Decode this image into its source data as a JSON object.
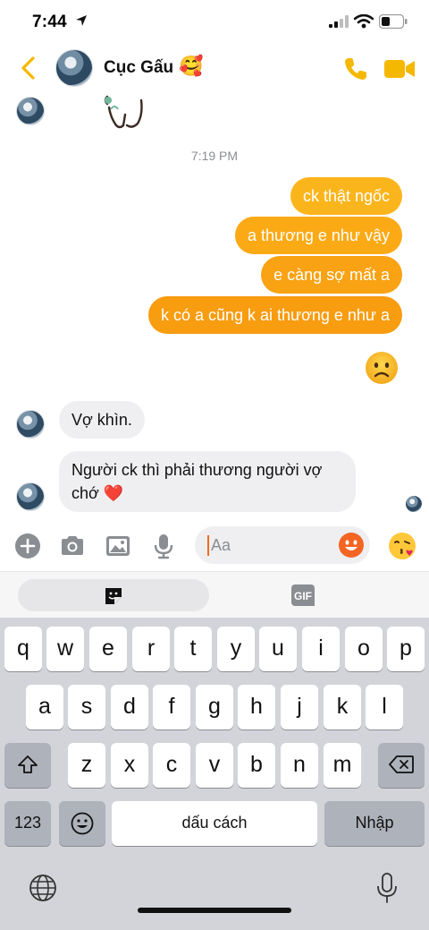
{
  "status_bar": {
    "time": "7:44",
    "icons": [
      "location-arrow-icon",
      "signal-icon",
      "wifi-icon",
      "battery-icon"
    ]
  },
  "header": {
    "contact_name": "Cục Gấu",
    "name_emoji": "🥰",
    "icons": [
      "back-chevron-icon",
      "phone-icon",
      "video-camera-icon"
    ],
    "accent_color": "#f5b800"
  },
  "conversation": {
    "timestamp": "7:19 PM",
    "outgoing": [
      "ck thật ngốc",
      "a thương e như vậy",
      "e càng sợ mất a",
      "k có a cũng k ai thương e như a"
    ],
    "incoming": [
      "Vợ khìn.",
      "Người ck thì phải thương người vợ chớ ❤️"
    ],
    "outgoing_gradient": [
      "#fbb51c",
      "#f89c10"
    ],
    "incoming_bg": "#efeff1"
  },
  "composer": {
    "placeholder": "Aa",
    "value": "",
    "icons": [
      "plus-icon",
      "camera-icon",
      "image-icon",
      "microphone-icon",
      "smiley-icon",
      "kiss-emoji-icon"
    ]
  },
  "tray": {
    "tabs": [
      "sticker-icon",
      "GIF"
    ]
  },
  "keyboard": {
    "row1": [
      "q",
      "w",
      "e",
      "r",
      "t",
      "y",
      "u",
      "i",
      "o",
      "p"
    ],
    "row2": [
      "a",
      "s",
      "d",
      "f",
      "g",
      "h",
      "j",
      "k",
      "l"
    ],
    "row3": [
      "z",
      "x",
      "c",
      "v",
      "b",
      "n",
      "m"
    ],
    "numbers_label": "123",
    "space_label": "dấu cách",
    "return_label": "Nhập"
  }
}
